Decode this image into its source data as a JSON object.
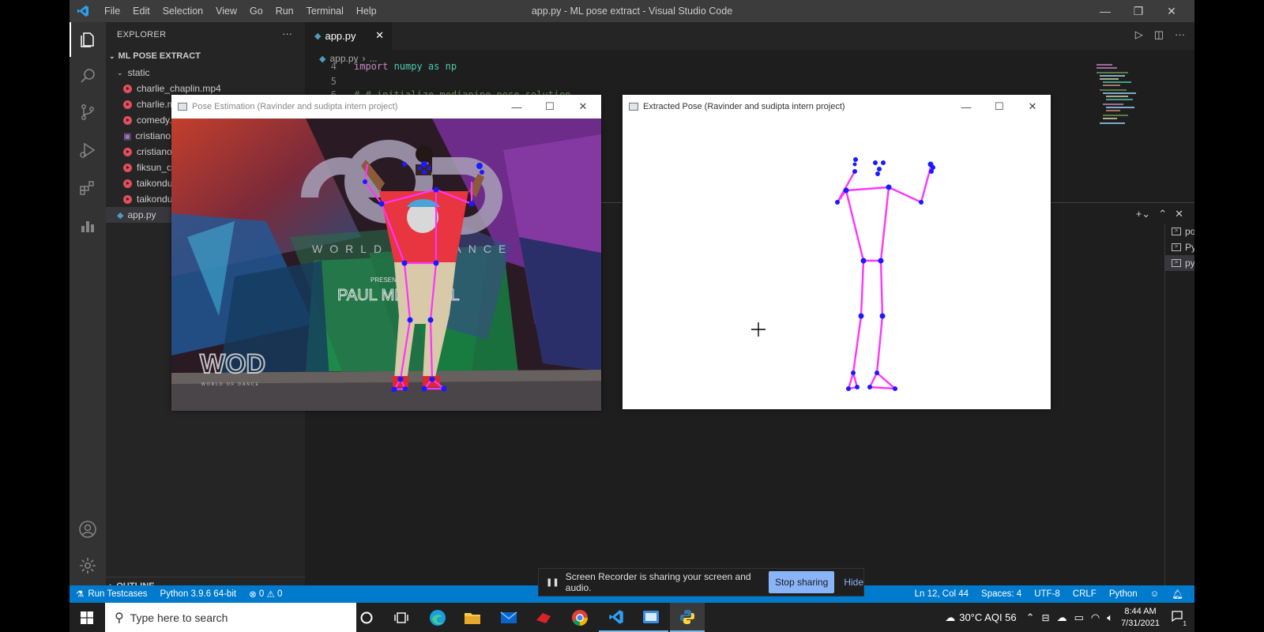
{
  "titlebar": {
    "menus": [
      "File",
      "Edit",
      "Selection",
      "View",
      "Go",
      "Run",
      "Terminal",
      "Help"
    ],
    "title": "app.py - ML pose extract - Visual Studio Code"
  },
  "sidebar": {
    "header": "EXPLORER",
    "more": "···",
    "project": "ML POSE EXTRACT",
    "folder": "static",
    "files": [
      "charlie_chaplin.mp4",
      "charlie.m",
      "comedy.",
      "cristiano",
      "cristiano",
      "fiksun_cl",
      "taikondu",
      "taikondu"
    ],
    "app_file": "app.py",
    "outline": "OUTLINE"
  },
  "editor": {
    "tab_label": "app.py",
    "breadcrumb_file": "app.py",
    "breadcrumb_rest": "...",
    "lines": [
      {
        "num": "4",
        "kw": "import",
        "rest": " numpy as np"
      },
      {
        "num": "5",
        "kw": "",
        "rest": ""
      },
      {
        "num": "6",
        "kw": "",
        "rest": "# # initialize mediapipe pose solution"
      }
    ]
  },
  "terminals": [
    "powershell",
    "Python",
    "python"
  ],
  "pose_window": {
    "title": "Pose Estimation (Ravinder and sudipta intern project)",
    "banner_text": "WORLD OF DANCE",
    "presented": "PRESENTED",
    "sponsor": "PAUL MITCHELL",
    "logo": "WOD",
    "logo_sub": "WORLD OF DANCE"
  },
  "extract_window": {
    "title": "Extracted Pose (Ravinder and sudipta intern project)"
  },
  "statusbar": {
    "run_testcases": "Run Testcases",
    "interpreter": "Python 3.9.6 64-bit",
    "errors": "0",
    "warnings": "0",
    "position": "Ln 12, Col 44",
    "spaces": "Spaces: 4",
    "encoding": "UTF-8",
    "eol": "CRLF",
    "language": "Python"
  },
  "notification": {
    "text": "Screen Recorder is sharing your screen and audio.",
    "stop_label": "Stop sharing",
    "hide_label": "Hide"
  },
  "taskbar": {
    "search_placeholder": "Type here to search",
    "weather": "30°C AQI 56",
    "time": "8:44 AM",
    "date": "7/31/2021",
    "notif_count": "1"
  },
  "colors": {
    "vscode_blue": "#007acc",
    "skeleton": "#ff33ff",
    "joint": "#1a1aff"
  }
}
